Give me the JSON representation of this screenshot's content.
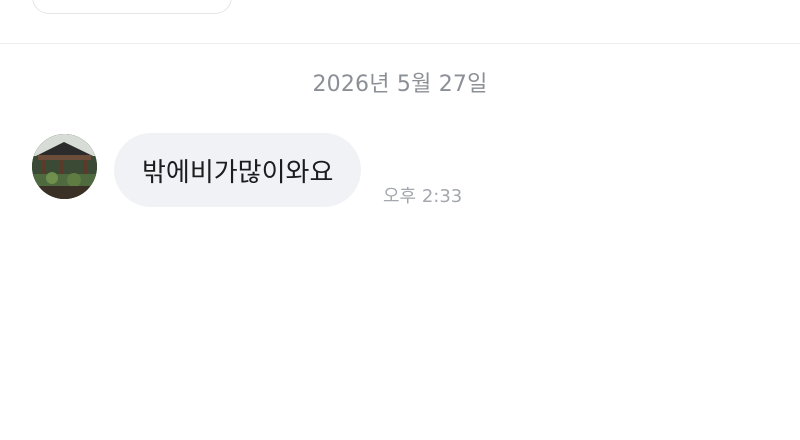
{
  "date_separator": "2026년 5월 27일",
  "messages": [
    {
      "text": "밖에비가많이와요",
      "time": "오후 2:33",
      "avatar": "pavilion-photo-avatar"
    }
  ]
}
